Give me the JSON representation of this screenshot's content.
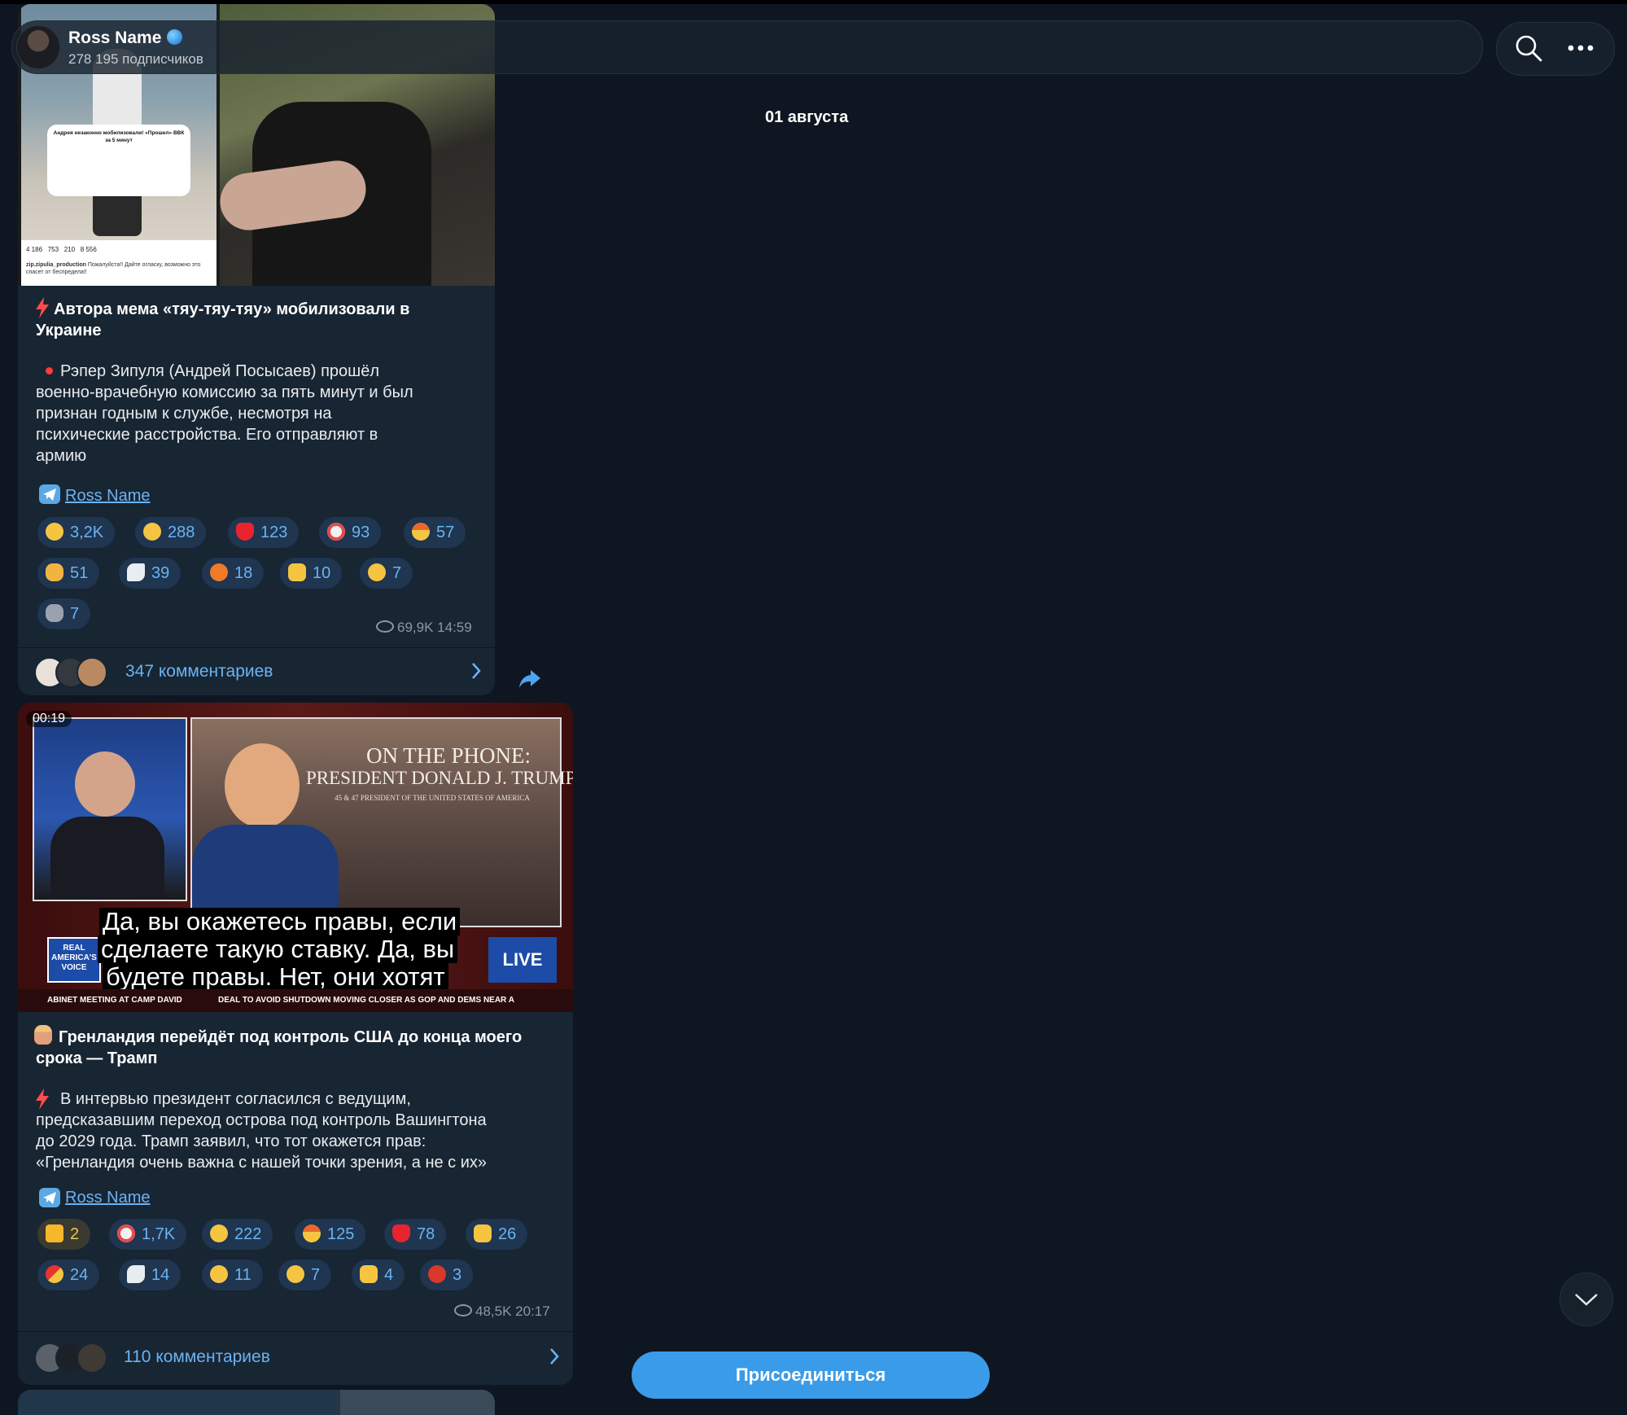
{
  "header": {
    "channel_name": "Ross Name",
    "subscribers": "278 195 подписчиков",
    "verified_icon": "globe-icon"
  },
  "date_separator": "01 августа",
  "posts": [
    {
      "title": "Автора мема «тяу-тяу-тяу» мобилизовали в Украине",
      "body_lines": [
        "Рэпер Зипуля (Андрей Посысаев) прошёл",
        "военно-врачебную комиссию за пять минут и был",
        "признан годным к службе, несмотря на",
        "психические расстройства. Его отправляют в",
        "армию"
      ],
      "source": "Ross Name",
      "reactions": [
        {
          "emoji": "crying-face",
          "count": "3,2K"
        },
        {
          "emoji": "rofl-face",
          "count": "288"
        },
        {
          "emoji": "red-heart",
          "count": "123"
        },
        {
          "emoji": "clown-face",
          "count": "93"
        },
        {
          "emoji": "exploding-head",
          "count": "57"
        },
        {
          "emoji": "pointing-hand",
          "count": "51"
        },
        {
          "emoji": "dove",
          "count": "39"
        },
        {
          "emoji": "angry-face",
          "count": "18"
        },
        {
          "emoji": "thumbs-up",
          "count": "10"
        },
        {
          "emoji": "grinning-face",
          "count": "7"
        },
        {
          "emoji": "elephant",
          "count": "7"
        }
      ],
      "views": "69,9K",
      "time": "14:59",
      "comments": "347 комментариев",
      "screenshot_overlay": {
        "likes": "4 186",
        "comments": "753",
        "reposts": "210",
        "views": "8 556",
        "author": "zip.zipulia_production",
        "caption": "Пожалуйста!! Дайте огласку, возможно это спасет от беспредела!!",
        "note": "Андрея незаконно мобилизовали! «Прошел» ВВК за 5 минут"
      }
    },
    {
      "video_duration": "00:19",
      "video_title_1": "ON THE PHONE:",
      "video_title_2": "PRESIDENT DONALD J. TRUMP",
      "video_title_3": "45 & 47 PRESIDENT OF THE UNITED STATES OF AMERICA",
      "ticker_left": "ABINET MEETING AT CAMP DAVID",
      "ticker_right": "DEAL TO AVOID SHUTDOWN MOVING CLOSER AS GOP AND DEMS NEAR A",
      "live_badge": "LIVE",
      "network_badge": "REAL AMERICA'S VOICE",
      "subtitle_lines": [
        "Да, вы окажетесь правы, если",
        "сделаете такую ставку. Да, вы",
        "будете правы. Нет, они хотят"
      ],
      "title": "Гренландия перейдёт под контроль США до конца моего срока — Трамп",
      "body_lines": [
        "В интервью президент согласился с ведущим,",
        "предсказавшим переход острова под контроль Вашингтона",
        "до 2029 года. Трамп заявил, что тот окажется прав:",
        "«Гренландия очень важна с нашей точки зрения, а не с их»"
      ],
      "source": "Ross Name",
      "reactions": [
        {
          "emoji": "star",
          "count": "2"
        },
        {
          "emoji": "clown-face",
          "count": "1,7K"
        },
        {
          "emoji": "rofl-face",
          "count": "222"
        },
        {
          "emoji": "exploding-head",
          "count": "125"
        },
        {
          "emoji": "red-heart",
          "count": "78"
        },
        {
          "emoji": "thumbs-up",
          "count": "26"
        },
        {
          "emoji": "pill",
          "count": "24"
        },
        {
          "emoji": "dove",
          "count": "14"
        },
        {
          "emoji": "grinning-face",
          "count": "11"
        },
        {
          "emoji": "woozy-face",
          "count": "7"
        },
        {
          "emoji": "thumbs-down",
          "count": "4"
        },
        {
          "emoji": "cursing-face",
          "count": "3"
        }
      ],
      "views": "48,5K",
      "time": "20:17",
      "comments": "110 комментариев"
    }
  ],
  "join_button": "Присоединиться",
  "colors": {
    "bg": "#0e1621",
    "bubble": "#182533",
    "accent": "#6ab3f3",
    "button": "#3a9be8"
  }
}
